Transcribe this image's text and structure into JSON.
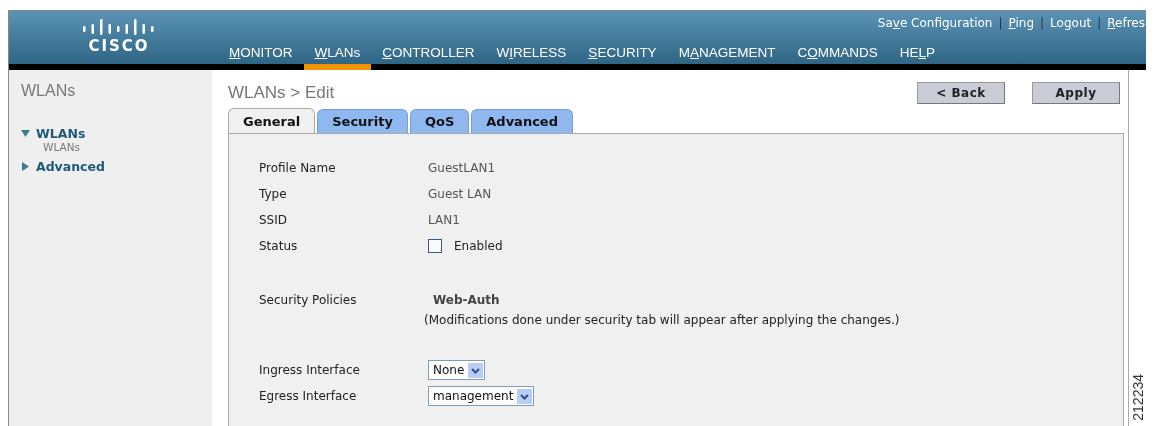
{
  "header": {
    "logo": "CISCO",
    "top_links": [
      {
        "pre": "Sa",
        "key": "v",
        "post": "e Configuration"
      },
      {
        "separator": "|",
        "key": "P",
        "post": "ing"
      },
      {
        "separator": "|",
        "pre": "Lo",
        "key": "g",
        "post": "out"
      },
      {
        "separator": "|",
        "key": "R",
        "post": "efres"
      }
    ],
    "nav": [
      {
        "key": "M",
        "post": "ONITOR",
        "selected": false
      },
      {
        "key": "W",
        "post": "LANs",
        "selected": true
      },
      {
        "key": "C",
        "post": "ONTROLLER",
        "selected": false
      },
      {
        "pre": "W",
        "key": "I",
        "post": "RELESS",
        "selected": false
      },
      {
        "key": "S",
        "post": "ECURITY",
        "selected": false
      },
      {
        "pre": "M",
        "key": "A",
        "post": "NAGEMENT",
        "selected": false
      },
      {
        "pre": "C",
        "key": "O",
        "post": "MMANDS",
        "selected": false
      },
      {
        "pre": "HE",
        "key": "L",
        "post": "P",
        "selected": false
      }
    ]
  },
  "sidebar": {
    "title": "WLANs",
    "items": [
      {
        "label": "WLANs",
        "expanded": true,
        "children": [
          {
            "label": "WLANs"
          }
        ]
      },
      {
        "label": "Advanced",
        "expanded": false
      }
    ]
  },
  "page_title": "WLANs > Edit",
  "buttons": [
    "< Back",
    "Apply"
  ],
  "tabs": [
    {
      "label": "General",
      "selected": true
    },
    {
      "label": "Security",
      "selected": false
    },
    {
      "label": "QoS",
      "selected": false
    },
    {
      "label": "Advanced",
      "selected": false
    }
  ],
  "fields": [
    {
      "kind": "text",
      "label": "Profile Name",
      "value": "GuestLAN1"
    },
    {
      "kind": "text",
      "label": "Type",
      "value": "Guest LAN"
    },
    {
      "kind": "text",
      "label": "SSID",
      "value": "LAN1"
    },
    {
      "kind": "checkbox",
      "label": "Status",
      "value": "Enabled",
      "checked": false
    },
    {
      "kind": "spacer"
    },
    {
      "kind": "policy",
      "label": "Security Policies",
      "value": "Web-Auth",
      "note": "(Modifications done under security tab will appear after applying the changes.)"
    },
    {
      "kind": "spacer"
    },
    {
      "kind": "select",
      "label": "Ingress Interface",
      "value": "None"
    },
    {
      "kind": "select",
      "label": "Egress Interface",
      "value": "management"
    }
  ],
  "figure_id": "212234"
}
